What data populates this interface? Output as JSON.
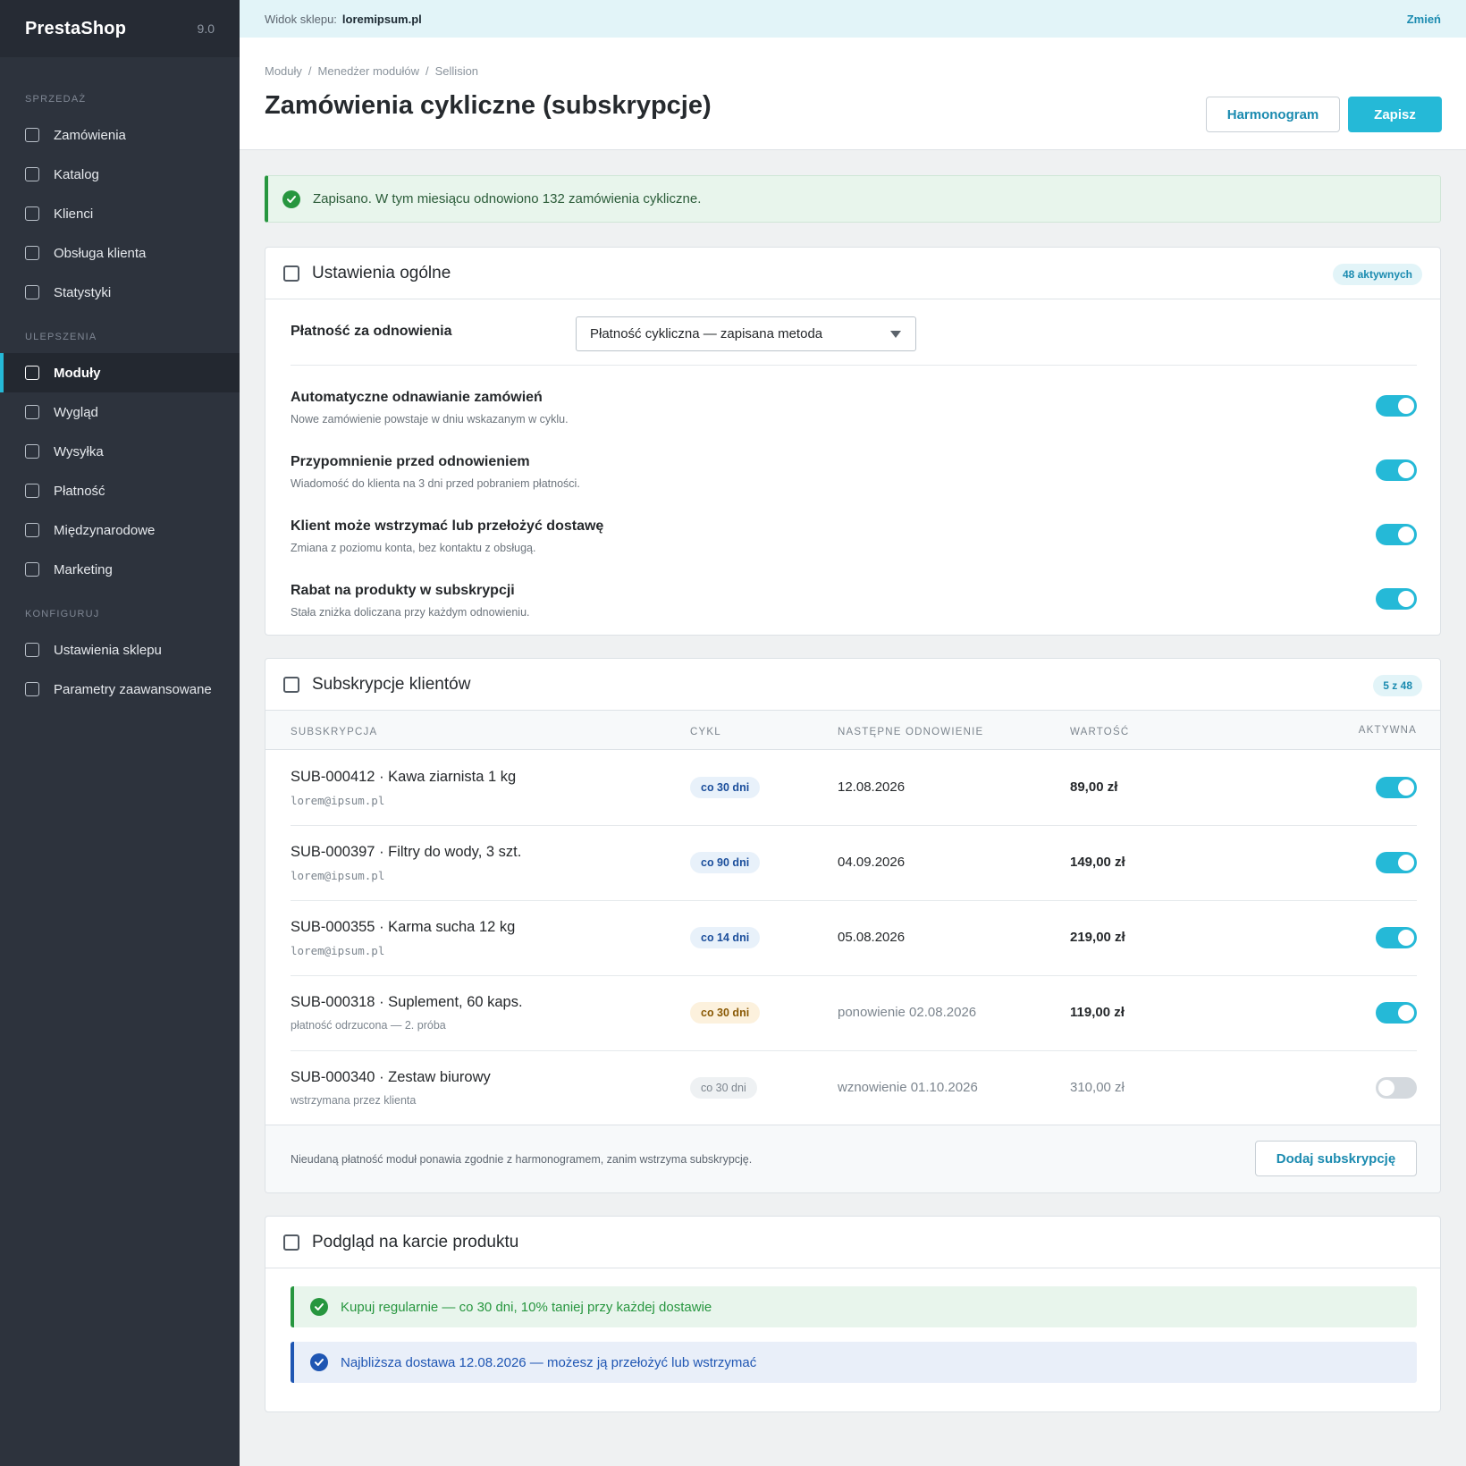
{
  "sidebar": {
    "brand": "PrestaShop",
    "version": "9.0",
    "sections": [
      {
        "title": "SPRZEDAŻ",
        "items": [
          "Zamówienia",
          "Katalog",
          "Klienci",
          "Obsługa klienta",
          "Statystyki"
        ]
      },
      {
        "title": "ULEPSZENIA",
        "items": [
          "Moduły",
          "Wygląd",
          "Wysyłka",
          "Płatność",
          "Międzynarodowe",
          "Marketing"
        ]
      },
      {
        "title": "KONFIGURUJ",
        "items": [
          "Ustawienia sklepu",
          "Parametry zaawansowane"
        ]
      }
    ],
    "active_item": "Moduły"
  },
  "shopbar": {
    "label": "Widok sklepu:",
    "domain": "loremipsum.pl",
    "change": "Zmień"
  },
  "header": {
    "breadcrumb": [
      "Moduły",
      "Menedżer modułów",
      "Sellision"
    ],
    "separator": "/",
    "title": "Zamówienia cykliczne (subskrypcje)",
    "schedule_button": "Harmonogram",
    "save_button": "Zapisz"
  },
  "alert": {
    "text": "Zapisano. W tym miesiącu odnowiono 132 zamówienia cykliczne."
  },
  "general": {
    "title": "Ustawienia ogólne",
    "badge": "48 aktywnych",
    "payment_label": "Płatność za odnowienia",
    "payment_value": "Płatność cykliczna — zapisana metoda",
    "settings": [
      {
        "label": "Automatyczne odnawianie zamówień",
        "desc": "Nowe zamówienie powstaje w dniu wskazanym w cyklu.",
        "enabled": true
      },
      {
        "label": "Przypomnienie przed odnowieniem",
        "desc": "Wiadomość do klienta na 3 dni przed pobraniem płatności.",
        "enabled": true
      },
      {
        "label": "Klient może wstrzymać lub przełożyć dostawę",
        "desc": "Zmiana z poziomu konta, bez kontaktu z obsługą.",
        "enabled": true
      },
      {
        "label": "Rabat na produkty w subskrypcji",
        "desc": "Stała zniżka doliczana przy każdym odnowieniu.",
        "enabled": true
      }
    ]
  },
  "subscriptions": {
    "title": "Subskrypcje klientów",
    "badge": "5 z 48",
    "columns": [
      "SUBSKRYPCJA",
      "CYKL",
      "NASTĘPNE ODNOWIENIE",
      "WARTOŚĆ",
      "AKTYWNA"
    ],
    "rows": [
      {
        "name": "SUB-000412 · Kawa ziarnista 1 kg",
        "sub": "lorem@ipsum.pl",
        "cycle": "co 30 dni",
        "next": "12.08.2026",
        "value": "89,00 zł",
        "active": true
      },
      {
        "name": "SUB-000397 · Filtry do wody, 3 szt.",
        "sub": "lorem@ipsum.pl",
        "cycle": "co 90 dni",
        "next": "04.09.2026",
        "value": "149,00 zł",
        "active": true
      },
      {
        "name": "SUB-000355 · Karma sucha 12 kg",
        "sub": "lorem@ipsum.pl",
        "cycle": "co 14 dni",
        "next": "05.08.2026",
        "value": "219,00 zł",
        "active": true
      },
      {
        "name": "SUB-000318 · Suplement, 60 kaps.",
        "sub": "płatność odrzucona — 2. próba",
        "cycle": "co 30 dni",
        "next": "ponowienie 02.08.2026",
        "value": "119,00 zł",
        "active": true
      },
      {
        "name": "SUB-000340 · Zestaw biurowy",
        "sub": "wstrzymana przez klienta",
        "cycle": "co 30 dni",
        "next": "wznowienie 01.10.2026",
        "value": "310,00 zł",
        "active": false
      }
    ],
    "footer_text": "Nieudaną płatność moduł ponawia zgodnie z harmonogramem, zanim wstrzyma subskrypcję.",
    "add_button": "Dodaj subskrypcję"
  },
  "preview": {
    "title": "Podgląd na karcie produktu",
    "lines": [
      "Kupuj regularnie — co 30 dni, 10% taniej przy każdej dostawie",
      "Najbliższa dostawa 12.08.2026 — możesz ją przełożyć lub wstrzymać"
    ]
  },
  "colors": {
    "primary": "#25b9d7",
    "link": "#1b8bb0",
    "sidebar": "#2d333d",
    "success": "#27963f",
    "info": "#1f56b3",
    "warning": "#8a5a06"
  }
}
